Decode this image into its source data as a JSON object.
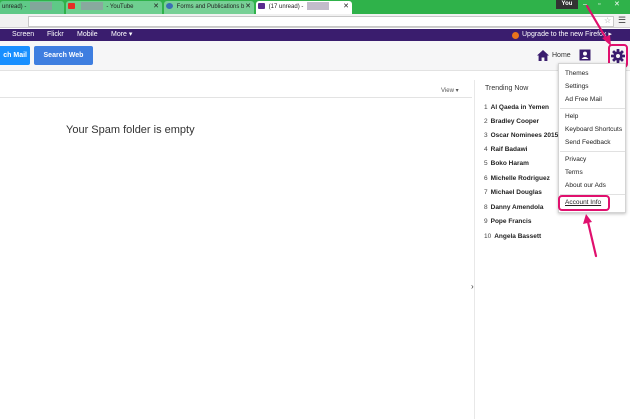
{
  "browser": {
    "tabs": [
      {
        "label": "unread) -",
        "kind": "mail"
      },
      {
        "label": "- YouTube",
        "kind": "youtube"
      },
      {
        "label": "Forms and Publications b",
        "kind": "web"
      },
      {
        "label": "(17 unread) -",
        "kind": "mail"
      }
    ],
    "user_badge": "You",
    "window_controls": [
      "–",
      "▫",
      "✕"
    ]
  },
  "nav": {
    "items": [
      "Screen",
      "Flickr",
      "Mobile",
      "More ▾"
    ],
    "upgrade": "Upgrade to the new Firefox ▸"
  },
  "search": {
    "mail_button": "ch Mail",
    "web_button": "Search Web"
  },
  "header": {
    "home_label": "Home"
  },
  "main": {
    "view_label": "View ▾",
    "empty_message": "Your Spam folder is empty",
    "collapse_glyph": "›"
  },
  "trending": {
    "title": "Trending Now",
    "items": [
      {
        "n": "1",
        "t": "Al Qaeda in Yemen"
      },
      {
        "n": "2",
        "t": "Bradley Cooper"
      },
      {
        "n": "3",
        "t": "Oscar Nominees 2015"
      },
      {
        "n": "4",
        "t": "Raif Badawi"
      },
      {
        "n": "5",
        "t": "Boko Haram"
      },
      {
        "n": "6",
        "t": "Michelle Rodriguez"
      },
      {
        "n": "7",
        "t": "Michael Douglas"
      },
      {
        "n": "8",
        "t": "Danny Amendola"
      },
      {
        "n": "9",
        "t": "Pope Francis"
      },
      {
        "n": "10",
        "t": "Angela Bassett"
      }
    ]
  },
  "settings_menu": {
    "groups": [
      [
        "Themes",
        "Settings",
        "Ad Free Mail"
      ],
      [
        "Help",
        "Keyboard Shortcuts",
        "Send Feedback"
      ],
      [
        "Privacy",
        "Terms",
        "About our Ads"
      ],
      [
        "Account Info"
      ]
    ]
  },
  "colors": {
    "tabbar": "#2fb24a",
    "navbar": "#3a1d6e",
    "annotation": "#e0106e",
    "primary_button": "#188fff"
  }
}
